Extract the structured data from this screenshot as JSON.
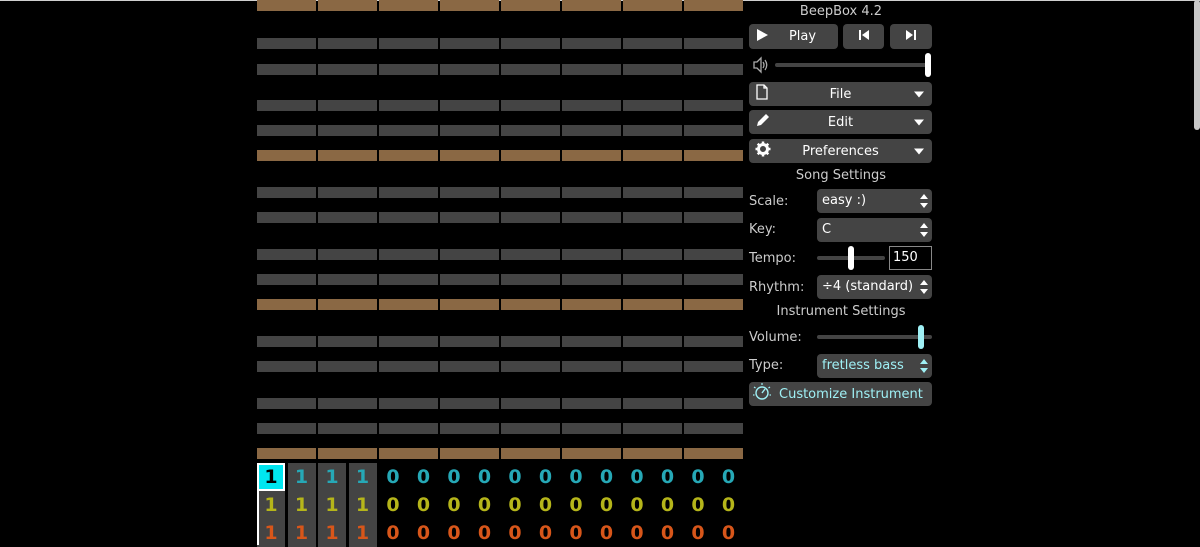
{
  "app": {
    "title": "BeepBox 4.2"
  },
  "transport": {
    "play_label": "Play"
  },
  "menus": {
    "file": "File",
    "edit": "Edit",
    "preferences": "Preferences"
  },
  "song_settings": {
    "heading": "Song Settings",
    "scale_label": "Scale:",
    "scale_value": "easy :)",
    "key_label": "Key:",
    "key_value": "C",
    "tempo_label": "Tempo:",
    "tempo_value": "150",
    "rhythm_label": "Rhythm:",
    "rhythm_value": "÷4 (standard)"
  },
  "instrument_settings": {
    "heading": "Instrument Settings",
    "volume_label": "Volume:",
    "type_label": "Type:",
    "type_value": "fretless bass",
    "customize_label": "Customize Instrument"
  },
  "levels": {
    "master_volume": 1.0,
    "instrument_volume": 0.93,
    "tempo_fraction": 0.5
  },
  "tracks": [
    {
      "color": "#26a8b6",
      "patterns": [
        "1",
        "1",
        "1",
        "1",
        "0",
        "0",
        "0",
        "0",
        "0",
        "0",
        "0",
        "0",
        "0",
        "0",
        "0",
        "0"
      ]
    },
    {
      "color": "#b5b51a",
      "patterns": [
        "1",
        "1",
        "1",
        "1",
        "0",
        "0",
        "0",
        "0",
        "0",
        "0",
        "0",
        "0",
        "0",
        "0",
        "0",
        "0"
      ]
    },
    {
      "color": "#d7561a",
      "patterns": [
        "1",
        "1",
        "1",
        "1",
        "0",
        "0",
        "0",
        "0",
        "0",
        "0",
        "0",
        "0",
        "0",
        "0",
        "0",
        "0"
      ]
    }
  ],
  "colors": {
    "accent": "#00e6f0",
    "octave_row": "#8a6844",
    "note_row": "#444444"
  },
  "icons": {
    "play": "play-icon",
    "prev": "skip-back-icon",
    "next": "skip-forward-icon",
    "volume": "speaker-icon",
    "file": "document-icon",
    "edit": "pencil-icon",
    "prefs": "gear-icon",
    "customize": "knob-icon"
  }
}
